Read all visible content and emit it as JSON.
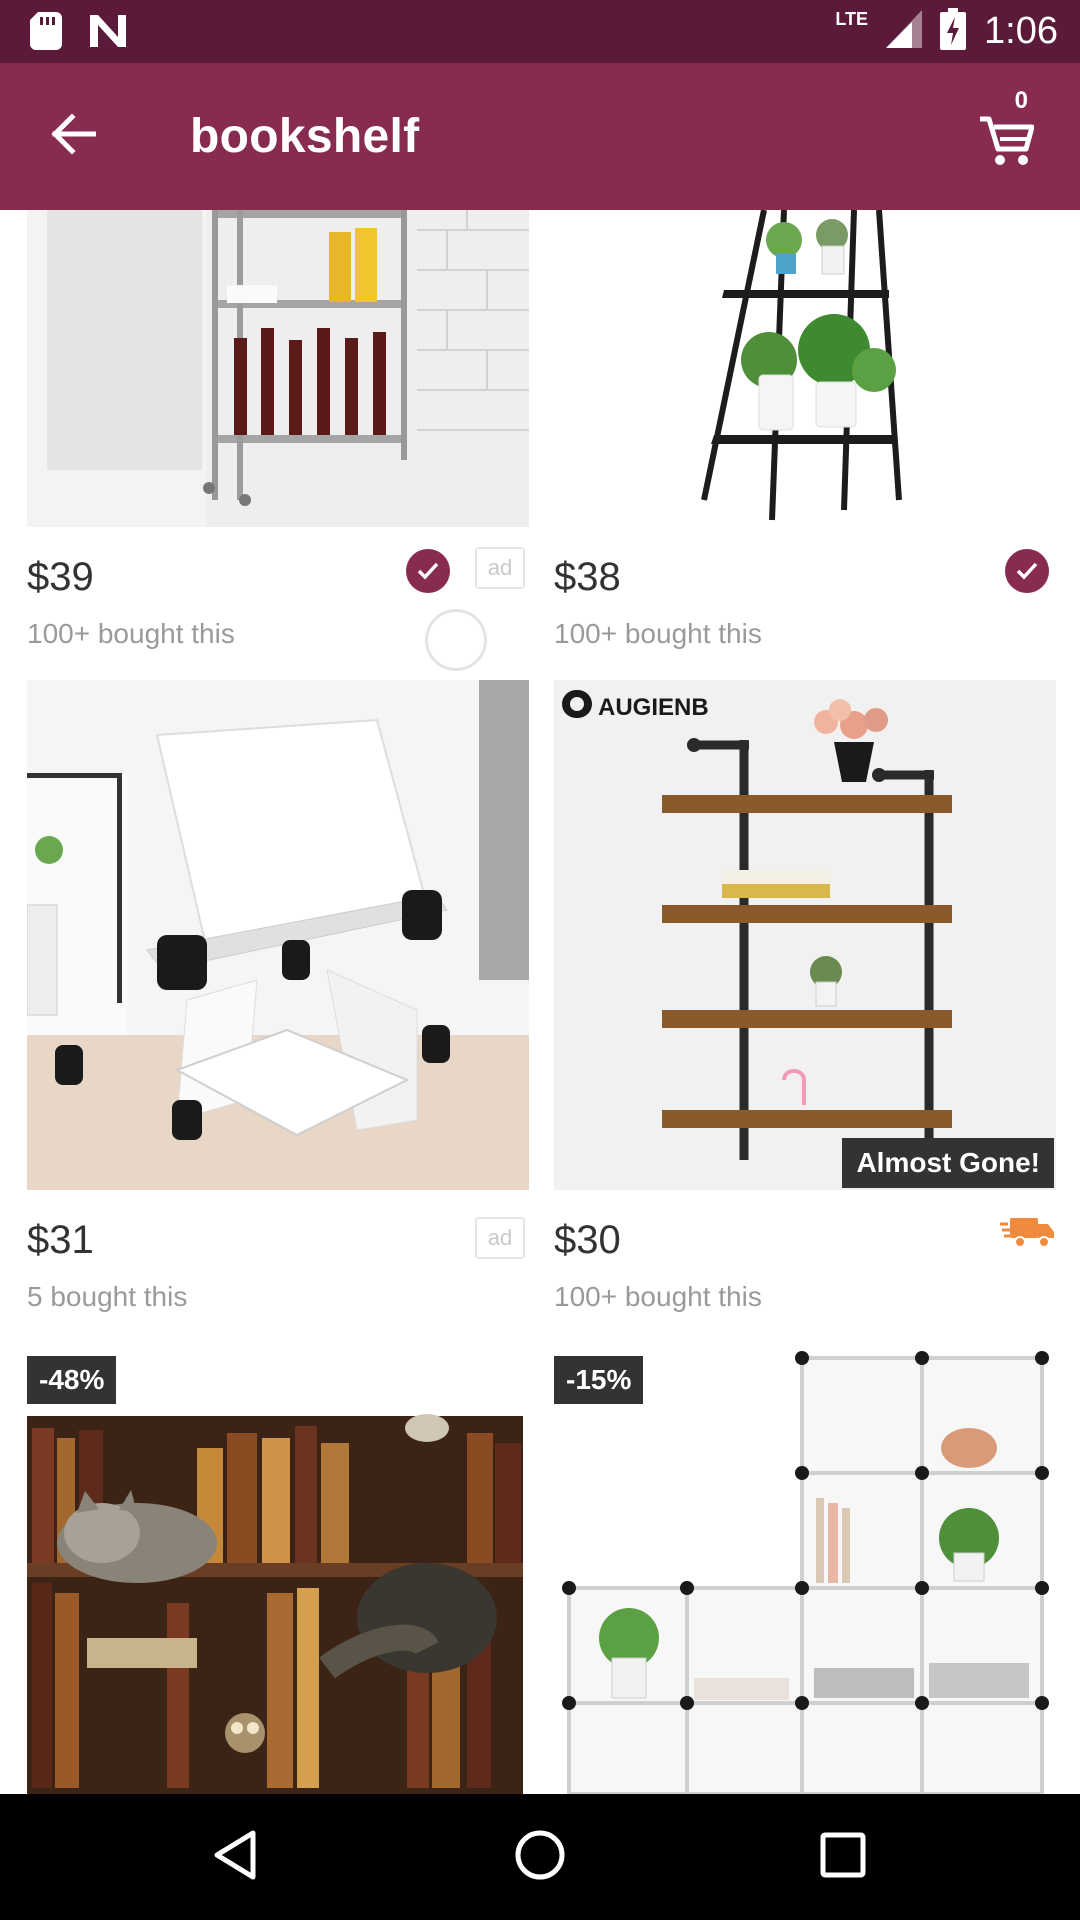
{
  "status_bar": {
    "network": "LTE",
    "time": "1:06",
    "icons": [
      "sd-card-icon",
      "n-notification-icon",
      "signal-icon",
      "battery-charging-icon"
    ]
  },
  "app_bar": {
    "title": "bookshelf",
    "cart_count": "0",
    "back_icon": "arrow-left-icon",
    "cart_icon": "shopping-cart-icon",
    "color": "#872b51"
  },
  "products": [
    {
      "price": "$39",
      "bought": "100+ bought this",
      "ad": "ad",
      "verified": true
    },
    {
      "price": "$38",
      "bought": "100+ bought this",
      "verified": true
    },
    {
      "price": "$31",
      "bought": "5 bought this",
      "ad": "ad"
    },
    {
      "price": "$30",
      "bought": "100+ bought this",
      "badge": "Almost Gone!",
      "brand": "AUGIENB",
      "shipping_icon": "fast-shipping-truck-icon"
    },
    {
      "discount": "-48%"
    },
    {
      "discount": "-15%"
    }
  ],
  "nav_bar": {
    "icons": [
      "back-triangle-icon",
      "home-circle-icon",
      "recents-square-icon"
    ]
  }
}
